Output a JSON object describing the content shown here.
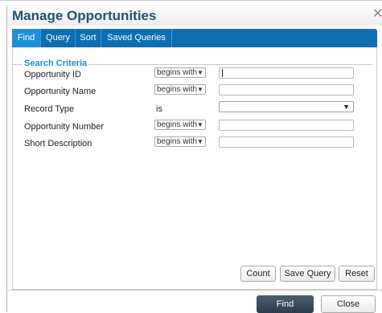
{
  "dialog": {
    "title": "Manage Opportunities",
    "close_glyph": "✕"
  },
  "tabs": [
    {
      "label": "Find",
      "active": true
    },
    {
      "label": "Query",
      "active": false
    },
    {
      "label": "Sort",
      "active": false
    },
    {
      "label": "Saved Queries",
      "active": false
    }
  ],
  "criteria": {
    "legend": "Search Criteria",
    "rows": [
      {
        "label": "Opportunity ID",
        "operator": "begins with",
        "value": ""
      },
      {
        "label": "Opportunity Name",
        "operator": "begins with",
        "value": ""
      },
      {
        "label": "Record Type",
        "operator": "is",
        "value": ""
      },
      {
        "label": "Opportunity Number",
        "operator": "begins with",
        "value": ""
      },
      {
        "label": "Short Description",
        "operator": "begins with",
        "value": ""
      }
    ]
  },
  "actions": {
    "count": "Count",
    "save_query": "Save Query",
    "reset": "Reset"
  },
  "footer": {
    "find": "Find",
    "close": "Close"
  },
  "colors": {
    "tab_bar": "#0b6fb2",
    "tab_active": "#1b8fd9",
    "title": "#224f7c",
    "primary_button": "#2b3b4d"
  }
}
